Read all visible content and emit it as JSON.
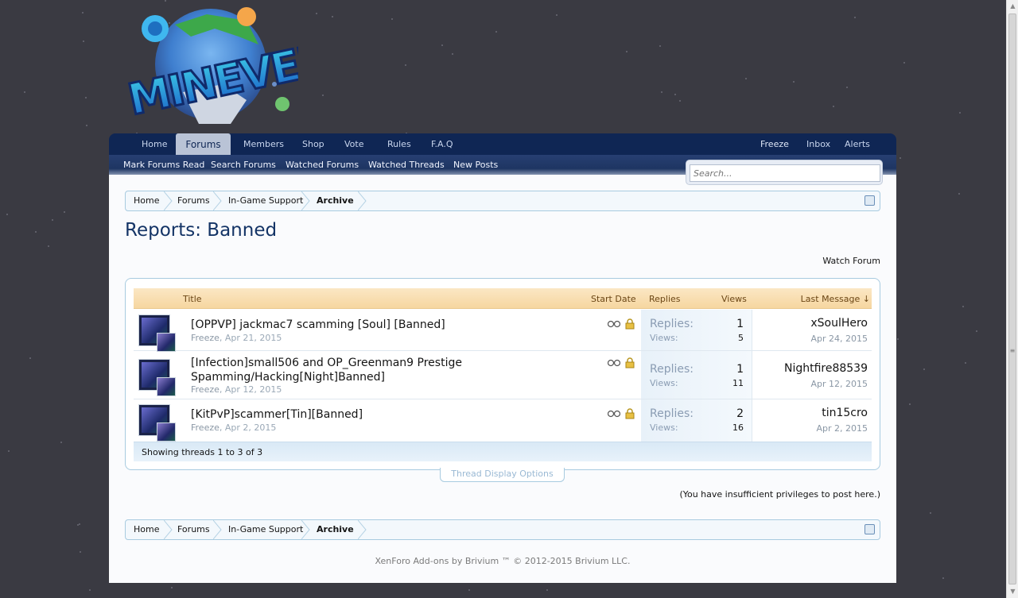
{
  "colors": {
    "background": "#3a3a42",
    "nav_dark": "#0f2654",
    "title": "#143466",
    "header_orange": "#f6d6a0"
  },
  "logo": {
    "alt_text": "MINEVERSE"
  },
  "nav": {
    "tabs": [
      {
        "label": "Home"
      },
      {
        "label": "Forums"
      },
      {
        "label": "Members"
      },
      {
        "label": "Shop"
      },
      {
        "label": "Vote"
      },
      {
        "label": "Rules"
      },
      {
        "label": "F.A.Q"
      }
    ],
    "active_tab": "Forums",
    "user_links": [
      {
        "label": "Freeze"
      },
      {
        "label": "Inbox"
      },
      {
        "label": "Alerts"
      }
    ],
    "sub_links": [
      {
        "label": "Mark Forums Read"
      },
      {
        "label": "Search Forums"
      },
      {
        "label": "Watched Forums"
      },
      {
        "label": "Watched Threads"
      },
      {
        "label": "New Posts"
      }
    ]
  },
  "search": {
    "placeholder": "Search..."
  },
  "breadcrumb": [
    "Home",
    "Forums",
    "In-Game Support",
    "Archive"
  ],
  "page": {
    "title": "Reports: Banned",
    "watch_forum": "Watch Forum"
  },
  "table": {
    "headers": {
      "title": "Title",
      "start_date": "Start Date",
      "replies": "Replies",
      "views": "Views",
      "last_message": "Last Message ↓"
    },
    "replies_label": "Replies:",
    "views_label": "Views:",
    "threads": [
      {
        "title": "[OPPVP] jackmac7 scamming [Soul] [Banned]",
        "author": "Freeze",
        "date": "Apr 21, 2015",
        "replies": "1",
        "views": "5",
        "last_user": "xSoulHero",
        "last_date": "Apr 24, 2015"
      },
      {
        "title": "[Infection]small506 and OP_Greenman9 Prestige",
        "title_line2": "Spamming/Hacking[Night]Banned]",
        "author": "Freeze",
        "date": "Apr 12, 2015",
        "replies": "1",
        "views": "11",
        "last_user": "Nightfire88539",
        "last_date": "Apr 12, 2015"
      },
      {
        "title": "[KitPvP]scammer[Tin][Banned]",
        "author": "Freeze",
        "date": "Apr 2, 2015",
        "replies": "2",
        "views": "16",
        "last_user": "tin15cro",
        "last_date": "Apr 2, 2015"
      }
    ],
    "footer": "Showing threads 1 to 3 of 3"
  },
  "thread_display_options": "Thread Display Options",
  "no_permission": "(You have insufficient privileges to post here.)",
  "copyright": "XenForo Add-ons by Brivium ™ © 2012-2015 Brivium LLC."
}
